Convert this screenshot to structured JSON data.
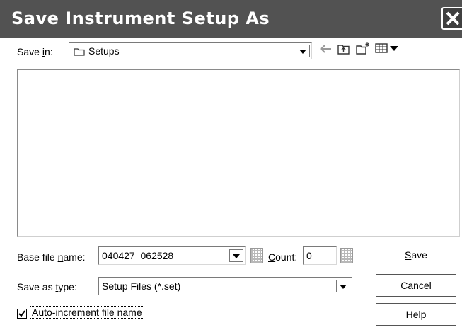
{
  "window": {
    "title": "Save Instrument Setup As",
    "close_icon": "close-icon"
  },
  "save_in": {
    "label_pre": "Save ",
    "label_mnemonic": "i",
    "label_post": "n:",
    "folder_icon": "folder-icon",
    "value": "Setups",
    "toolbar_icons": [
      "back-arrow-icon",
      "up-folder-icon",
      "new-folder-icon",
      "view-menu-icon"
    ]
  },
  "base_file_name": {
    "label_pre": "Base file ",
    "label_mnemonic": "n",
    "label_post": "ame:",
    "value": "040427_062528"
  },
  "count": {
    "label_mnemonic": "C",
    "label_post": "ount:",
    "value": "0"
  },
  "save_as_type": {
    "label_pre": "Save as ",
    "label_mnemonic": "t",
    "label_post": "ype:",
    "value": "Setup Files (*.set)"
  },
  "auto_increment": {
    "checked": true,
    "label": "Auto-increment file name"
  },
  "buttons": {
    "save_mnemonic": "S",
    "save_post": "ave",
    "cancel": "Cancel",
    "help": "Help"
  },
  "colors": {
    "titlebar": "#525252",
    "title_text": "#ffffff"
  }
}
